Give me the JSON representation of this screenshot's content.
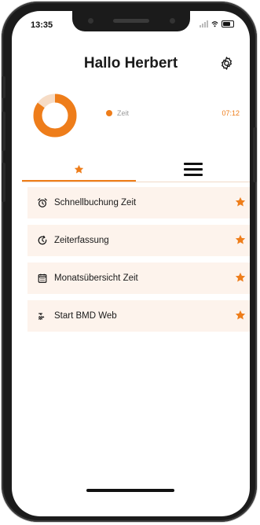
{
  "status_bar": {
    "time": "13:35"
  },
  "header": {
    "title": "Hallo Herbert",
    "settings_icon": "gear-icon"
  },
  "summary": {
    "donut_fraction": 0.85,
    "legend_label": "Zeit",
    "time_value": "07:12"
  },
  "tabs": [
    {
      "name": "favorites",
      "icon": "star-icon",
      "active": true
    },
    {
      "name": "menu",
      "icon": "hamburger-menu-icon",
      "active": false
    }
  ],
  "favorites": [
    {
      "label": "Schnellbuchung Zeit",
      "icon": "alarm-clock-icon"
    },
    {
      "label": "Zeiterfassung",
      "icon": "clock-history-icon"
    },
    {
      "label": "Monatsübersicht Zeit",
      "icon": "calendar-icon"
    },
    {
      "label": "Start BMD Web",
      "icon": "web-icon"
    }
  ],
  "colors": {
    "accent": "#ee7d1a",
    "accent_light": "#f6dcc6",
    "list_bg": "#fdf3ec",
    "text": "#1a1a1a"
  }
}
